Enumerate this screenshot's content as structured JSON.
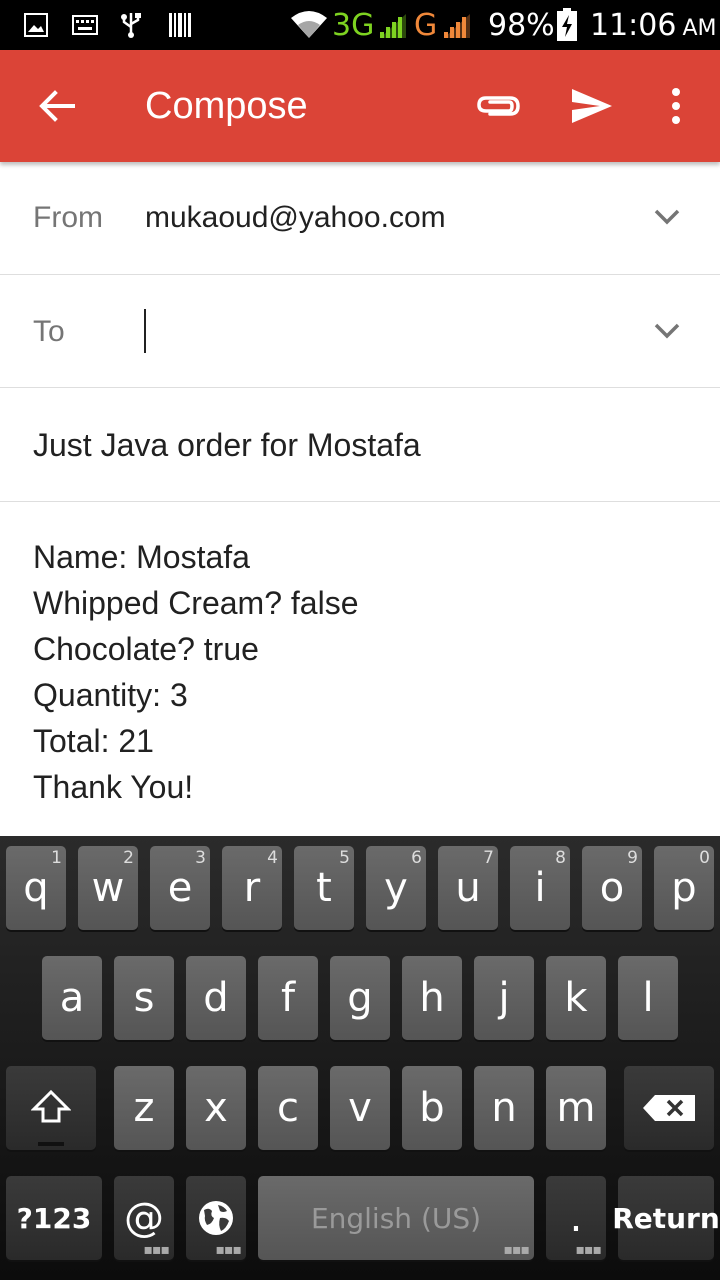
{
  "status_bar": {
    "network_3g": "3G",
    "network_g": "G",
    "battery": "98%",
    "time": "11:06",
    "ampm": "AM"
  },
  "appbar": {
    "title": "Compose",
    "color": "#db4437"
  },
  "from": {
    "label": "From",
    "value": "mukaoud@yahoo.com"
  },
  "to": {
    "label": "To",
    "value": ""
  },
  "subject": "Just Java order for Mostafa",
  "body": {
    "lines": [
      "Name: Mostafa",
      "Whipped Cream? false",
      "Chocolate? true",
      "Quantity: 3",
      "Total: 21",
      "Thank You!"
    ]
  },
  "keyboard": {
    "row1": [
      "q",
      "w",
      "e",
      "r",
      "t",
      "y",
      "u",
      "i",
      "o",
      "p"
    ],
    "row1_numbers": [
      "1",
      "2",
      "3",
      "4",
      "5",
      "6",
      "7",
      "8",
      "9",
      "0"
    ],
    "row2": [
      "a",
      "s",
      "d",
      "f",
      "g",
      "h",
      "j",
      "k",
      "l"
    ],
    "row3": [
      "z",
      "x",
      "c",
      "v",
      "b",
      "n",
      "m"
    ],
    "symbols_key": "?123",
    "at_key": "@",
    "space_label": "English (US)",
    "period_key": ".",
    "return_key": "Return"
  }
}
